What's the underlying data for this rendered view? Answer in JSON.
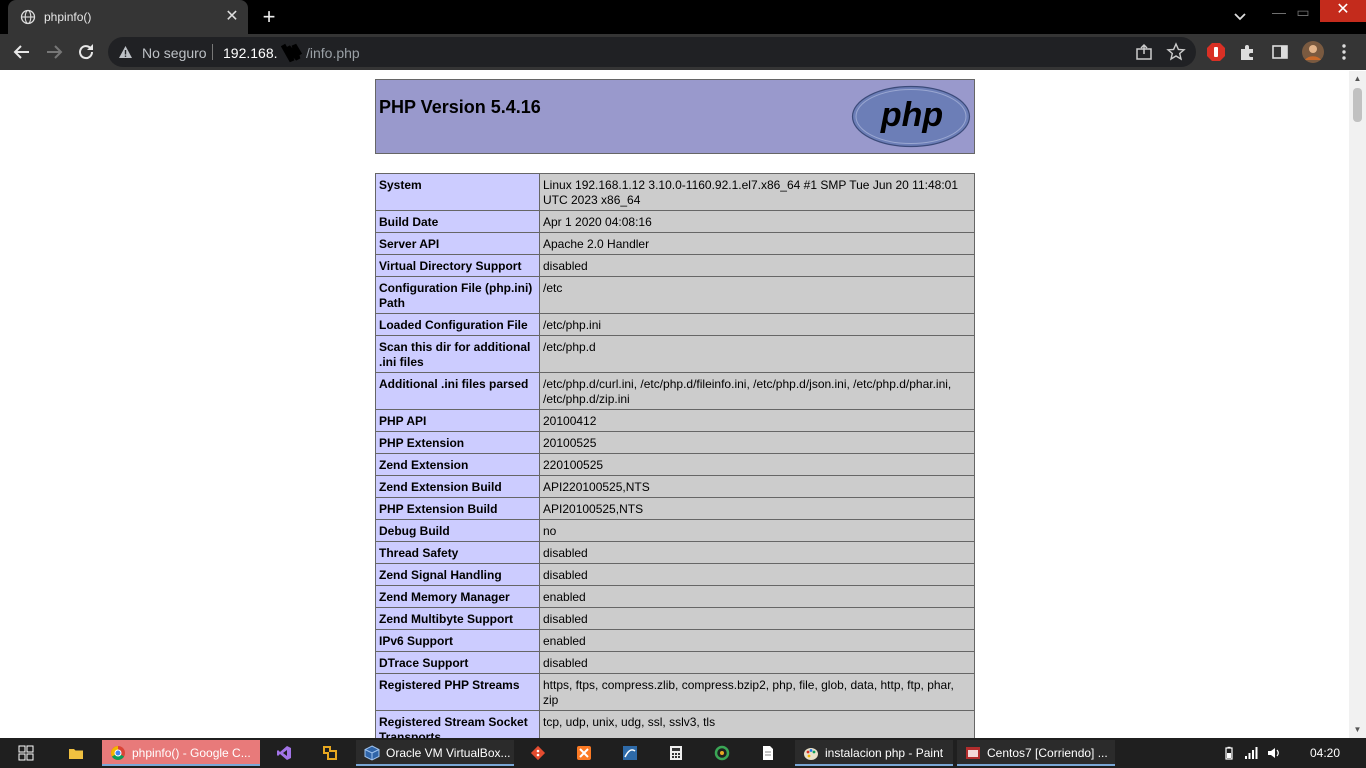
{
  "browser": {
    "tab_title": "phpinfo()",
    "security_label": "No seguro",
    "url_host": "192.168.",
    "url_path": "/info.php"
  },
  "page": {
    "heading": "PHP Version 5.4.16",
    "logo_text": "php",
    "rows": [
      {
        "label": "System",
        "value": "Linux 192.168.1.12 3.10.0-1160.92.1.el7.x86_64 #1 SMP Tue Jun 20 11:48:01 UTC 2023 x86_64"
      },
      {
        "label": "Build Date",
        "value": "Apr 1 2020 04:08:16"
      },
      {
        "label": "Server API",
        "value": "Apache 2.0 Handler"
      },
      {
        "label": "Virtual Directory Support",
        "value": "disabled"
      },
      {
        "label": "Configuration File (php.ini) Path",
        "value": "/etc"
      },
      {
        "label": "Loaded Configuration File",
        "value": "/etc/php.ini"
      },
      {
        "label": "Scan this dir for additional .ini files",
        "value": "/etc/php.d"
      },
      {
        "label": "Additional .ini files parsed",
        "value": "/etc/php.d/curl.ini, /etc/php.d/fileinfo.ini, /etc/php.d/json.ini, /etc/php.d/phar.ini, /etc/php.d/zip.ini"
      },
      {
        "label": "PHP API",
        "value": "20100412"
      },
      {
        "label": "PHP Extension",
        "value": "20100525"
      },
      {
        "label": "Zend Extension",
        "value": "220100525"
      },
      {
        "label": "Zend Extension Build",
        "value": "API220100525,NTS"
      },
      {
        "label": "PHP Extension Build",
        "value": "API20100525,NTS"
      },
      {
        "label": "Debug Build",
        "value": "no"
      },
      {
        "label": "Thread Safety",
        "value": "disabled"
      },
      {
        "label": "Zend Signal Handling",
        "value": "disabled"
      },
      {
        "label": "Zend Memory Manager",
        "value": "enabled"
      },
      {
        "label": "Zend Multibyte Support",
        "value": "disabled"
      },
      {
        "label": "IPv6 Support",
        "value": "enabled"
      },
      {
        "label": "DTrace Support",
        "value": "disabled"
      },
      {
        "label": "Registered PHP Streams",
        "value": "https, ftps, compress.zlib, compress.bzip2, php, file, glob, data, http, ftp, phar, zip"
      },
      {
        "label": "Registered Stream Socket Transports",
        "value": "tcp, udp, unix, udg, ssl, sslv3, tls"
      }
    ]
  },
  "taskbar": {
    "tasks": [
      {
        "label": "phpinfo() - Google C...",
        "icon": "chrome-icon"
      },
      {
        "label": "Oracle VM VirtualBox...",
        "icon": "virtualbox-icon"
      },
      {
        "label": "instalacion php - Paint",
        "icon": "paint-icon"
      },
      {
        "label": "Centos7 [Corriendo] ...",
        "icon": "vm-window-icon"
      }
    ],
    "clock": "04:20"
  }
}
